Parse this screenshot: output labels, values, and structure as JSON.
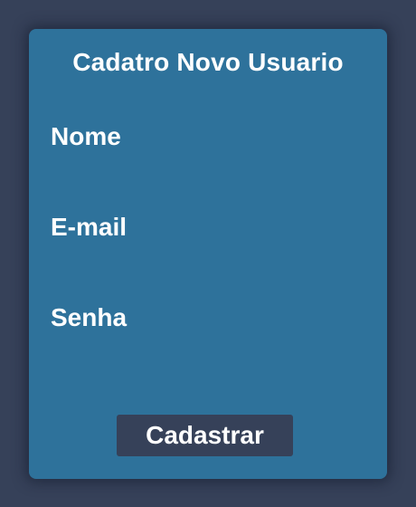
{
  "colors": {
    "page_background": "#364159",
    "card_background": "#2e729b",
    "button_background": "#364159",
    "text": "#ffffff"
  },
  "form": {
    "title": "Cadatro Novo Usuario",
    "fields": [
      {
        "label": "Nome",
        "value": "",
        "placeholder": ""
      },
      {
        "label": "E-mail",
        "value": "",
        "placeholder": ""
      },
      {
        "label": "Senha",
        "value": "",
        "placeholder": ""
      }
    ],
    "submit_label": "Cadastrar"
  }
}
